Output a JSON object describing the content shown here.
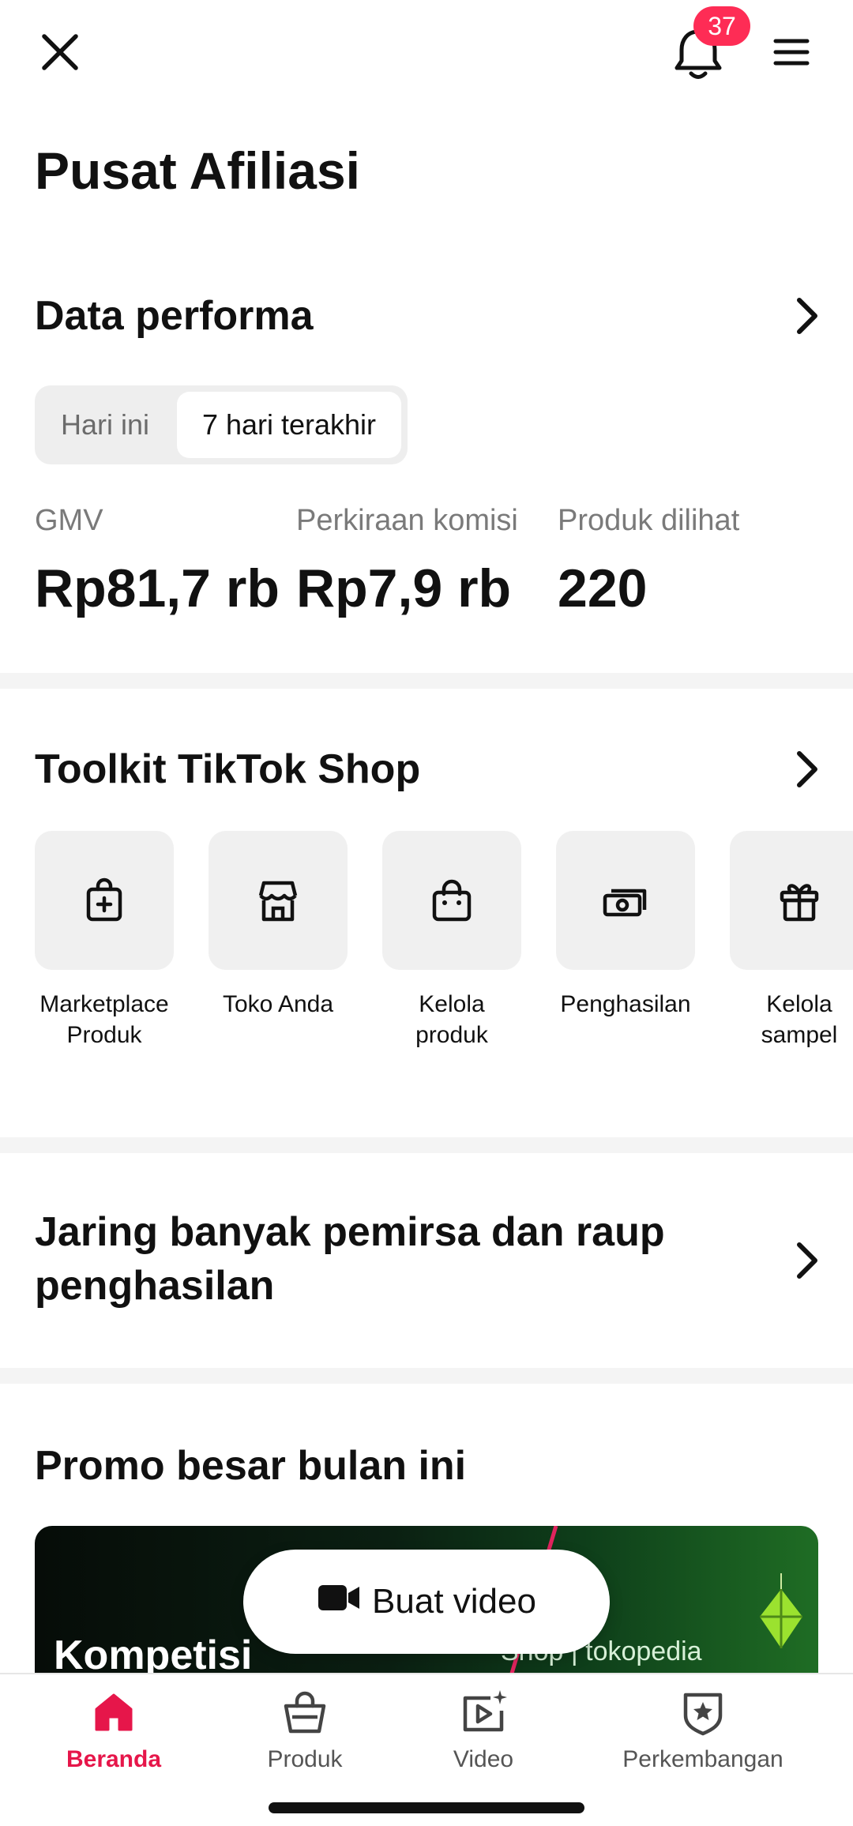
{
  "header": {
    "notification_count": "37",
    "icons": [
      "close-icon",
      "bell-icon",
      "menu-icon"
    ]
  },
  "page_title": "Pusat Afiliasi",
  "performance": {
    "title": "Data performa",
    "period_options": [
      "Hari ini",
      "7 hari terakhir"
    ],
    "selected_period": "7 hari terakhir",
    "metrics": [
      {
        "label": "GMV",
        "value": "Rp81,7 rb"
      },
      {
        "label": "Perkiraan komisi",
        "value": "Rp7,9 rb"
      },
      {
        "label": "Produk dilihat",
        "value": "220"
      }
    ]
  },
  "toolkit": {
    "title": "Toolkit TikTok Shop",
    "items": [
      {
        "label": "Marketplace\nProduk",
        "icon": "bag-plus-icon"
      },
      {
        "label": "Toko Anda",
        "icon": "store-icon"
      },
      {
        "label": "Kelola\nproduk",
        "icon": "shopping-bag-icon"
      },
      {
        "label": "Penghasilan",
        "icon": "money-icon"
      },
      {
        "label": "Kelola\nsampel",
        "icon": "gift-icon"
      }
    ]
  },
  "reach": {
    "title": "Jaring banyak pemirsa dan raup penghasilan"
  },
  "promo": {
    "title": "Promo besar bulan ini",
    "banner_text": "Kompetisi",
    "banner_brand": "Shop | tokopedia"
  },
  "cta": {
    "label": "Buat video",
    "icon": "video-camera-icon"
  },
  "bottom_nav": {
    "active": "Beranda",
    "accent_color": "#e6164a",
    "items": [
      {
        "label": "Beranda",
        "icon": "home-icon"
      },
      {
        "label": "Produk",
        "icon": "basket-icon"
      },
      {
        "label": "Video",
        "icon": "video-play-icon"
      },
      {
        "label": "Perkembangan",
        "icon": "shield-star-icon"
      }
    ]
  }
}
